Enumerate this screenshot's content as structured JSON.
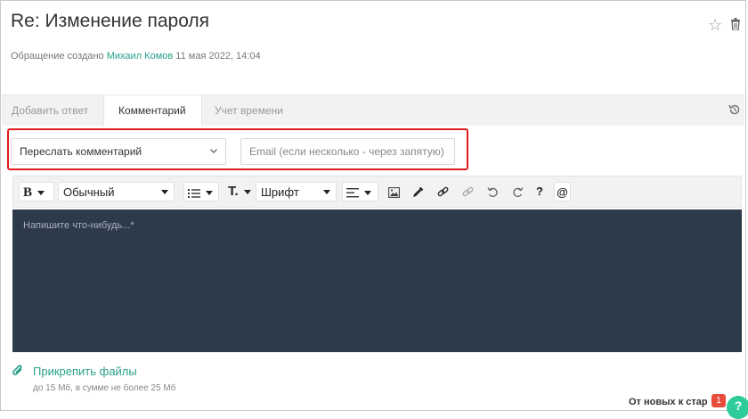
{
  "ticket": {
    "title": "Re: Изменение пароля",
    "created_prefix": "Обращение создано",
    "author": "Михаил Комов",
    "date": "11 мая 2022, 14:04"
  },
  "tabs": [
    {
      "label": "Добавить ответ",
      "active": false
    },
    {
      "label": "Комментарий",
      "active": true
    },
    {
      "label": "Учет времени",
      "active": false
    }
  ],
  "forward": {
    "select_value": "Переслать комментарий",
    "email_placeholder": "Email (если несколько - через запятую)"
  },
  "toolbar": {
    "bold_label": "B",
    "paragraph_style": "Обычный",
    "font_size_label": "T.",
    "font_label": "Шрифт",
    "help_label": "?",
    "mention_label": "@"
  },
  "editor": {
    "placeholder": "Напишите что-нибудь...*",
    "background": "#2d3a4a"
  },
  "attachments": {
    "label": "Прикрепить файлы",
    "limits": "до 15 Мб, в сумме не более 25 Мб"
  },
  "footer": {
    "sort_label": "От новых к стар",
    "badge_count": "1",
    "help_glyph": "?"
  },
  "colors": {
    "accent": "#27a08a",
    "highlight_border": "#e11b1b",
    "badge": "#e74c3c",
    "help_button": "#2ecc9a"
  }
}
